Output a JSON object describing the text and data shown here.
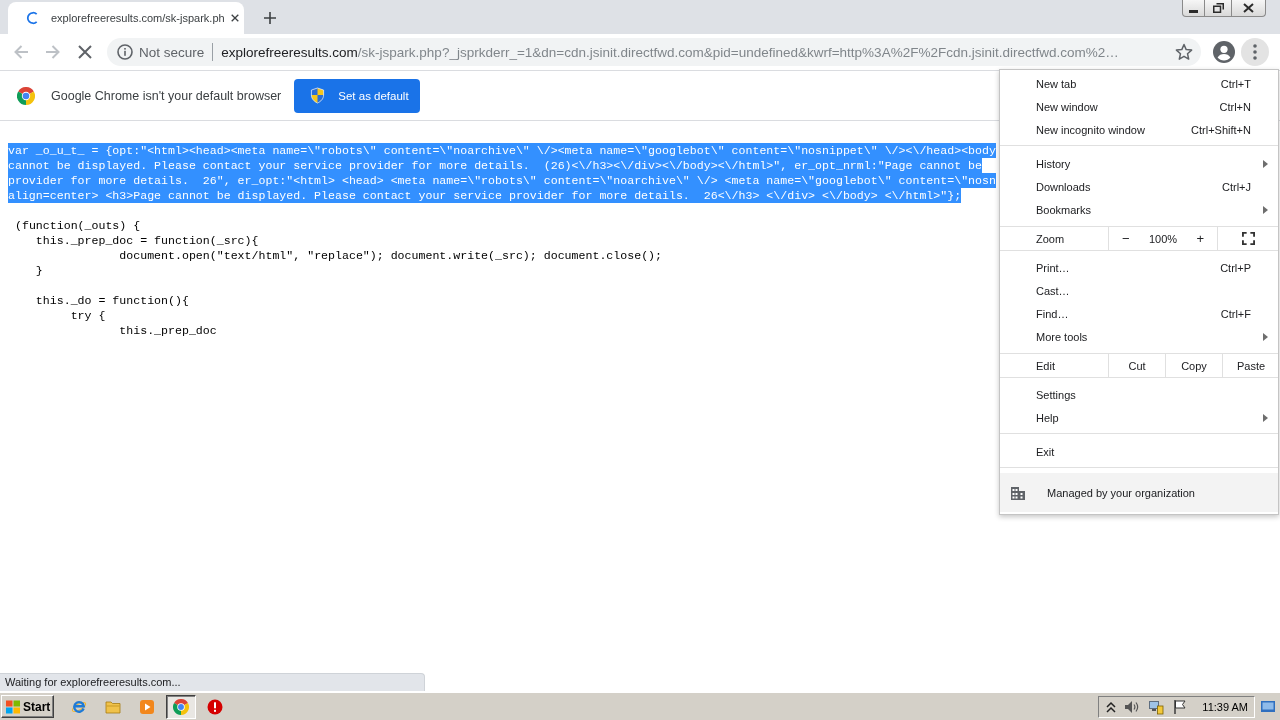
{
  "tabs": [
    {
      "title": "explorefreeresults.com/sk-jspark.ph",
      "selected": true,
      "loading": true
    }
  ],
  "nav_buttons": [
    {
      "kind": "back",
      "disabled": true
    },
    {
      "kind": "forward",
      "disabled": true
    },
    {
      "kind": "stop",
      "disabled": false
    }
  ],
  "omnibox": {
    "security": "Not secure",
    "host": "explorefreeresults.com",
    "path": "/sk-jspark.php?_jsprkderr_=1&dn=cdn.jsinit.directfwd.com&pid=undefined&kwrf=http%3A%2F%2Fcdn.jsinit.directfwd.com%2…",
    "starred": false
  },
  "infobar": {
    "message": "Google Chrome isn't your default browser",
    "button": "Set as default"
  },
  "code": {
    "blocks": [
      [
        {
          "text": "var _o_u_t_ = {opt:\"<html><head><meta name=\\\"robots\\\" content=\\\"noarchive\\\" \\/><meta name=\\\"googlebot\\\" content=\\\"nosnippet\\\" \\/><\\/head><body",
          "selected": true
        },
        {
          "text": "cannot be displayed. Please contact your service provider for more details.  (26)<\\/h3><\\/div><\\/body><\\/html>\", er_opt_nrml:\"Page cannot be",
          "selected": true
        },
        {
          "text": "provider for more details.  26\", er_opt:\"<html> <head> <meta name=\\\"robots\\\" content=\\\"noarchive\\\" \\/> <meta name=\\\"googlebot\\\" content=\\\"nosn",
          "selected": true
        },
        {
          "text": "align=center> <h3>Page cannot be displayed. Please contact your service provider for more details.  26<\\/h3> <\\/div> <\\/body> <\\/html>\"};",
          "selected": true
        }
      ],
      [
        {
          "text": " (function(_outs) {",
          "selected": false
        },
        {
          "text": "    this._prep_doc = function(_src){",
          "selected": false
        },
        {
          "text": "                document.open(\"text/html\", \"replace\"); document.write(_src); document.close();",
          "selected": false
        },
        {
          "text": "    }",
          "selected": false
        }
      ],
      [
        {
          "text": "    this._do = function(){",
          "selected": false
        },
        {
          "text": "         try {",
          "selected": false
        },
        {
          "text": "                this._prep_doc",
          "selected": false
        }
      ]
    ]
  },
  "status_bubble": "Waiting for explorefreeresults.com...",
  "app_menu": {
    "open": true,
    "items": [
      {
        "kind": "item",
        "label": "New tab",
        "shortcut": "Ctrl+T",
        "submenu": false
      },
      {
        "kind": "item",
        "label": "New window",
        "shortcut": "Ctrl+N",
        "submenu": false
      },
      {
        "kind": "item",
        "label": "New incognito window",
        "shortcut": "Ctrl+Shift+N",
        "submenu": false
      },
      {
        "kind": "separator"
      },
      {
        "kind": "item",
        "label": "History",
        "submenu": true
      },
      {
        "kind": "item",
        "label": "Downloads",
        "shortcut": "Ctrl+J",
        "submenu": false
      },
      {
        "kind": "item",
        "label": "Bookmarks",
        "submenu": true
      },
      {
        "kind": "zoom",
        "label": "Zoom",
        "minus": "−",
        "value": "100%",
        "plus": "+"
      },
      {
        "kind": "item",
        "label": "Print…",
        "shortcut": "Ctrl+P",
        "submenu": false
      },
      {
        "kind": "item",
        "label": "Cast…",
        "submenu": false
      },
      {
        "kind": "item",
        "label": "Find…",
        "shortcut": "Ctrl+F",
        "submenu": false
      },
      {
        "kind": "item",
        "label": "More tools",
        "submenu": true
      },
      {
        "kind": "edit",
        "label": "Edit",
        "actions": [
          "Cut",
          "Copy",
          "Paste"
        ]
      },
      {
        "kind": "item",
        "label": "Settings",
        "submenu": false
      },
      {
        "kind": "item",
        "label": "Help",
        "submenu": true
      },
      {
        "kind": "separator"
      },
      {
        "kind": "item",
        "label": "Exit",
        "submenu": false
      },
      {
        "kind": "separator"
      },
      {
        "kind": "managed",
        "label": "Managed by your organization"
      }
    ]
  },
  "taskbar": {
    "start": "Start",
    "apps": [
      {
        "kind": "ie",
        "selected": false
      },
      {
        "kind": "explorer",
        "selected": false
      },
      {
        "kind": "media",
        "selected": false
      },
      {
        "kind": "chrome",
        "selected": true
      },
      {
        "kind": "alert",
        "selected": false
      }
    ],
    "clock": "11:39 AM"
  }
}
